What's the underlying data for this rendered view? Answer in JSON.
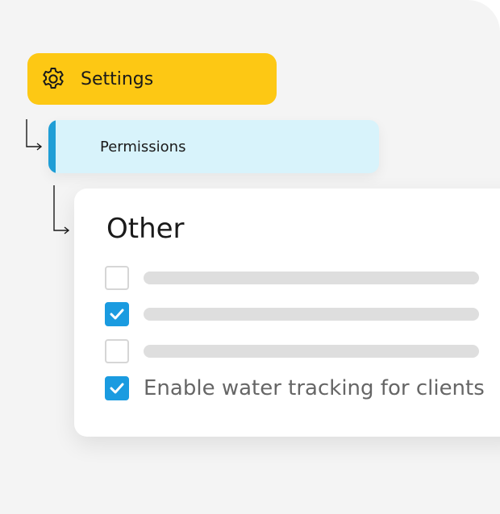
{
  "settings": {
    "label": "Settings",
    "icon": "gear-icon",
    "color": "#fdc814"
  },
  "permissions": {
    "label": "Permissions",
    "background": "#d8f3fb",
    "accent": "#1f9ed6"
  },
  "card": {
    "title": "Other",
    "items": [
      {
        "checked": false,
        "label": ""
      },
      {
        "checked": true,
        "label": ""
      },
      {
        "checked": false,
        "label": ""
      },
      {
        "checked": true,
        "label": "Enable water tracking for clients"
      }
    ]
  },
  "colors": {
    "checkbox_checked": "#1a9be0",
    "placeholder": "#dedede"
  }
}
